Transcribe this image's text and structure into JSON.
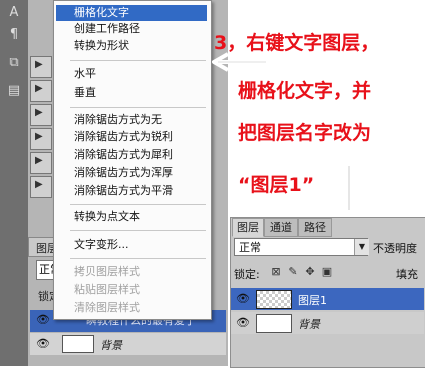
{
  "context_menu": {
    "items": [
      {
        "label": "栅格化文字",
        "state": "highlighted"
      },
      {
        "label": "创建工作路径",
        "state": "normal"
      },
      {
        "label": "转换为形状",
        "state": "normal"
      },
      {
        "label": "水平",
        "state": "normal"
      },
      {
        "label": "垂直",
        "state": "normal"
      },
      {
        "label": "消除锯齿方式为无",
        "state": "normal"
      },
      {
        "label": "消除锯齿方式为锐利",
        "state": "normal"
      },
      {
        "label": "消除锯齿方式为犀利",
        "state": "normal"
      },
      {
        "label": "消除锯齿方式为浑厚",
        "state": "normal"
      },
      {
        "label": "消除锯齿方式为平滑",
        "state": "normal"
      },
      {
        "label": "转换为点文本",
        "state": "normal"
      },
      {
        "label": "文字变形...",
        "state": "normal"
      },
      {
        "label": "拷贝图层样式",
        "state": "disabled"
      },
      {
        "label": "粘贴图层样式",
        "state": "disabled"
      },
      {
        "label": "清除图层样式",
        "state": "disabled"
      }
    ]
  },
  "annotation": {
    "line1": "3，右键文字图层，",
    "line2": "栅格化文字，并",
    "line3": "把图层名字改为",
    "line4": "“图层1”",
    "color": "#e8111a"
  },
  "left_layers_panel": {
    "tab": "图层",
    "blend_mode": "正常",
    "lock_label": "锁定",
    "text_layer_name": "瞬教程什么的最有爱了",
    "background_layer_name": "背景"
  },
  "right_layers_panel": {
    "tabs": [
      "图层",
      "通道",
      "路径"
    ],
    "blend_mode": "正常",
    "opacity_label": "不透明度",
    "lock_label": "锁定:",
    "fill_label": "填充",
    "layers": [
      {
        "name": "图层1",
        "selected": true
      },
      {
        "name": "背景",
        "selected": false
      }
    ]
  },
  "colors": {
    "selection_blue": "#316ac5",
    "layer_selected": "#3c67bf"
  }
}
